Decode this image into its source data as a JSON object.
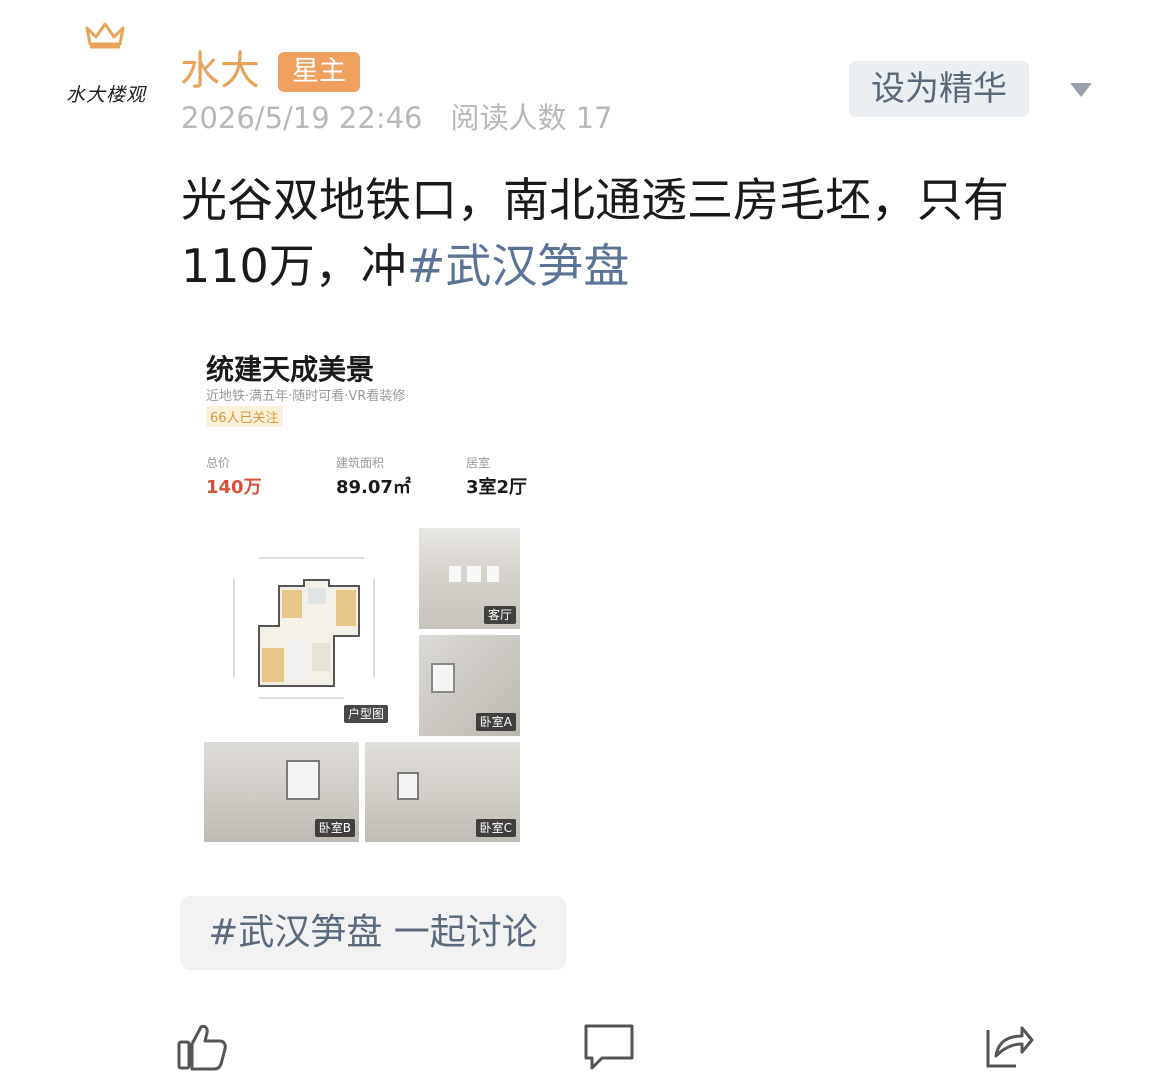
{
  "author": {
    "avatar_text": "水大楼观",
    "avatar_icon": "crown-icon",
    "name": "水大",
    "badge": "星主",
    "date": "2026/5/19 22:46",
    "read_count": "阅读人数 17"
  },
  "actions": {
    "essence_label": "设为精华",
    "dropdown_icon": "chevron-down-icon"
  },
  "post": {
    "text": "光谷双地铁口，南北通透三房毛坯，只有110万，冲",
    "hashtag": "#武汉笋盘"
  },
  "listing": {
    "title": "统建天成美景",
    "tags": "近地铁·满五年·随时可看·VR看装修",
    "followers": "66人已关注",
    "stats": [
      {
        "label": "总价",
        "value": "140万"
      },
      {
        "label": "建筑面积",
        "value": "89.07㎡"
      },
      {
        "label": "居室",
        "value": "3室2厅"
      }
    ],
    "photos": {
      "floorplan": "户型图",
      "living": "客厅",
      "bedroom_a": "卧室A",
      "bedroom_b": "卧室B",
      "bedroom_c": "卧室C"
    }
  },
  "topic": {
    "label": "#武汉笋盘 一起讨论"
  },
  "bottom_bar": [
    "like-icon",
    "comment-icon",
    "share-icon"
  ],
  "colors": {
    "author_name": "#e8a35a",
    "badge_bg": "#f0a15f",
    "hashtag": "#5b7397",
    "price": "#d5503a",
    "meta": "#b8b8b8"
  }
}
